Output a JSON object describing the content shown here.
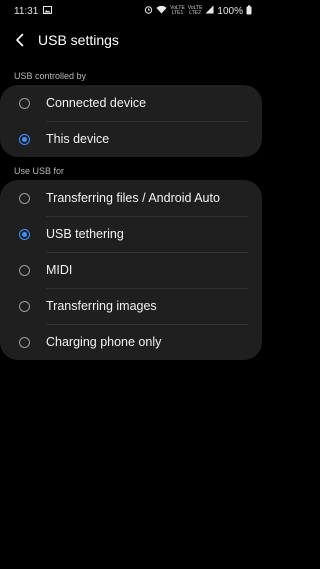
{
  "status_bar": {
    "time": "11:31",
    "battery": "100%",
    "sim1": "VoLTE\nLTE1",
    "sim2": "VoLTE\nLTE2",
    "icons": [
      "image-icon",
      "alarm-icon",
      "wifi-icon",
      "signal-icon",
      "battery-icon"
    ]
  },
  "header": {
    "title": "USB settings"
  },
  "sections": [
    {
      "label": "USB controlled by",
      "options": [
        {
          "label": "Connected device",
          "selected": false
        },
        {
          "label": "This device",
          "selected": true
        }
      ]
    },
    {
      "label": "Use USB for",
      "options": [
        {
          "label": "Transferring files / Android Auto",
          "selected": false
        },
        {
          "label": "USB tethering",
          "selected": true
        },
        {
          "label": "MIDI",
          "selected": false
        },
        {
          "label": "Transferring images",
          "selected": false
        },
        {
          "label": "Charging phone only",
          "selected": false
        }
      ]
    }
  ],
  "colors": {
    "accent": "#3e91ff",
    "card": "#1f1f1f",
    "background": "#000000"
  }
}
